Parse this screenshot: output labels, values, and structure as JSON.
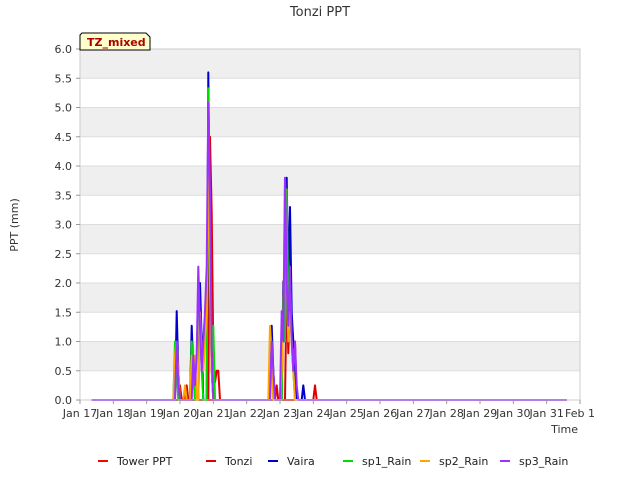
{
  "chart_data": {
    "type": "line",
    "title": "Tonzi PPT",
    "xlabel": "Time",
    "ylabel": "PPT (mm)",
    "badge": "TZ_mixed",
    "ylim": [
      0,
      6.0
    ],
    "xlim": [
      17,
      32
    ],
    "y_ticks": [
      "0.0",
      "0.5",
      "1.0",
      "1.5",
      "2.0",
      "2.5",
      "3.0",
      "3.5",
      "4.0",
      "4.5",
      "5.0",
      "5.5",
      "6.0"
    ],
    "x_ticks": [
      {
        "value": 17,
        "label": "Jan 17"
      },
      {
        "value": 18,
        "label": "Jan 18"
      },
      {
        "value": 19,
        "label": "Jan 19"
      },
      {
        "value": 20,
        "label": "Jan 20"
      },
      {
        "value": 21,
        "label": "Jan 21"
      },
      {
        "value": 22,
        "label": "Jan 22"
      },
      {
        "value": 23,
        "label": "Jan 23"
      },
      {
        "value": 24,
        "label": "Jan 24"
      },
      {
        "value": 25,
        "label": "Jan 25"
      },
      {
        "value": 26,
        "label": "Jan 26"
      },
      {
        "value": 27,
        "label": "Jan 27"
      },
      {
        "value": 28,
        "label": "Jan 28"
      },
      {
        "value": 29,
        "label": "Jan 29"
      },
      {
        "value": 30,
        "label": "Jan 30"
      },
      {
        "value": 31,
        "label": "Jan 31"
      },
      {
        "value": 32,
        "label": "Feb 1"
      }
    ],
    "grid": true,
    "legend_position": "bottom",
    "series": [
      {
        "name": "Tower PPT",
        "color": "#ff0000",
        "points": [
          [
            17.35,
            0
          ],
          [
            31.6,
            0
          ]
        ]
      },
      {
        "name": "Tonzi",
        "color": "#dd0000",
        "points": [
          [
            17.35,
            0
          ],
          [
            19.95,
            0
          ],
          [
            20.0,
            0.25
          ],
          [
            20.05,
            0
          ],
          [
            20.15,
            0
          ],
          [
            20.2,
            0.25
          ],
          [
            20.25,
            0
          ],
          [
            20.85,
            0
          ],
          [
            20.9,
            4.5
          ],
          [
            20.95,
            3.2
          ],
          [
            21.0,
            0.8
          ],
          [
            21.05,
            0.3
          ],
          [
            21.1,
            0.5
          ],
          [
            21.15,
            0.5
          ],
          [
            21.2,
            0
          ],
          [
            22.85,
            0
          ],
          [
            22.9,
            0.25
          ],
          [
            22.95,
            0
          ],
          [
            23.15,
            0
          ],
          [
            23.2,
            2.0
          ],
          [
            23.25,
            0.8
          ],
          [
            23.3,
            1.8
          ],
          [
            23.35,
            1.2
          ],
          [
            23.4,
            0.5
          ],
          [
            23.45,
            1.0
          ],
          [
            23.5,
            0
          ],
          [
            24.0,
            0
          ],
          [
            24.05,
            0.25
          ],
          [
            24.1,
            0
          ],
          [
            31.6,
            0
          ]
        ]
      },
      {
        "name": "Vaira",
        "color": "#0000cc",
        "points": [
          [
            17.35,
            0
          ],
          [
            19.85,
            0
          ],
          [
            19.9,
            1.52
          ],
          [
            19.95,
            0.5
          ],
          [
            20.0,
            0
          ],
          [
            20.3,
            0
          ],
          [
            20.35,
            1.27
          ],
          [
            20.4,
            0.5
          ],
          [
            20.45,
            0
          ],
          [
            20.55,
            0
          ],
          [
            20.6,
            2.0
          ],
          [
            20.65,
            1.0
          ],
          [
            20.7,
            0
          ],
          [
            20.8,
            0
          ],
          [
            20.85,
            5.6
          ],
          [
            20.9,
            2.5
          ],
          [
            20.95,
            0.5
          ],
          [
            21.0,
            0
          ],
          [
            22.7,
            0
          ],
          [
            22.75,
            1.27
          ],
          [
            22.8,
            0.5
          ],
          [
            22.85,
            0
          ],
          [
            23.05,
            0
          ],
          [
            23.1,
            2.03
          ],
          [
            23.15,
            1.0
          ],
          [
            23.2,
            3.8
          ],
          [
            23.25,
            2.0
          ],
          [
            23.3,
            3.3
          ],
          [
            23.35,
            1.5
          ],
          [
            23.4,
            1.0
          ],
          [
            23.45,
            0.5
          ],
          [
            23.5,
            0
          ],
          [
            23.65,
            0
          ],
          [
            23.7,
            0.25
          ],
          [
            23.75,
            0
          ],
          [
            31.6,
            0
          ]
        ]
      },
      {
        "name": "sp1_Rain",
        "color": "#00dd00",
        "points": [
          [
            17.35,
            0
          ],
          [
            19.8,
            0
          ],
          [
            19.85,
            1.0
          ],
          [
            19.9,
            0.5
          ],
          [
            19.95,
            0
          ],
          [
            20.3,
            0
          ],
          [
            20.35,
            1.0
          ],
          [
            20.4,
            0.5
          ],
          [
            20.45,
            0
          ],
          [
            20.55,
            0
          ],
          [
            20.6,
            1.5
          ],
          [
            20.65,
            0.5
          ],
          [
            20.7,
            0
          ],
          [
            20.8,
            0
          ],
          [
            20.85,
            5.33
          ],
          [
            20.9,
            2.0
          ],
          [
            20.95,
            0.8
          ],
          [
            21.0,
            1.27
          ],
          [
            21.05,
            0
          ],
          [
            22.7,
            0
          ],
          [
            22.75,
            1.0
          ],
          [
            22.8,
            0
          ],
          [
            23.05,
            0
          ],
          [
            23.1,
            1.78
          ],
          [
            23.15,
            1.0
          ],
          [
            23.2,
            3.6
          ],
          [
            23.25,
            1.5
          ],
          [
            23.3,
            2.0
          ],
          [
            23.35,
            1.0
          ],
          [
            23.4,
            0.5
          ],
          [
            23.45,
            0
          ],
          [
            31.6,
            0
          ]
        ]
      },
      {
        "name": "sp2_Rain",
        "color": "#ffa500",
        "points": [
          [
            17.35,
            0
          ],
          [
            19.8,
            0
          ],
          [
            19.85,
            0.76
          ],
          [
            19.9,
            1.0
          ],
          [
            19.95,
            0.5
          ],
          [
            20.0,
            0
          ],
          [
            20.1,
            0
          ],
          [
            20.15,
            0.25
          ],
          [
            20.2,
            0
          ],
          [
            20.3,
            0
          ],
          [
            20.35,
            0.76
          ],
          [
            20.4,
            0.5
          ],
          [
            20.45,
            0.76
          ],
          [
            20.5,
            0
          ],
          [
            20.55,
            0
          ],
          [
            20.6,
            1.5
          ],
          [
            20.65,
            0.76
          ],
          [
            20.7,
            0.5
          ],
          [
            20.75,
            1.0
          ],
          [
            20.8,
            1.5
          ],
          [
            20.85,
            4.5
          ],
          [
            20.9,
            2.0
          ],
          [
            20.95,
            0.5
          ],
          [
            21.0,
            0
          ],
          [
            22.65,
            0
          ],
          [
            22.7,
            1.27
          ],
          [
            22.75,
            0.76
          ],
          [
            22.8,
            0
          ],
          [
            23.0,
            0
          ],
          [
            23.05,
            0.5
          ],
          [
            23.1,
            1.27
          ],
          [
            23.15,
            3.8
          ],
          [
            23.2,
            2.03
          ],
          [
            23.25,
            1.0
          ],
          [
            23.3,
            1.5
          ],
          [
            23.35,
            1.0
          ],
          [
            23.4,
            0.5
          ],
          [
            23.45,
            0
          ],
          [
            31.6,
            0
          ]
        ]
      },
      {
        "name": "sp3_Rain",
        "color": "#9b30ff",
        "points": [
          [
            17.35,
            0
          ],
          [
            19.85,
            0
          ],
          [
            19.9,
            1.0
          ],
          [
            19.95,
            0.3
          ],
          [
            20.0,
            0
          ],
          [
            20.35,
            0
          ],
          [
            20.4,
            0.76
          ],
          [
            20.45,
            0.25
          ],
          [
            20.5,
            0.76
          ],
          [
            20.55,
            2.28
          ],
          [
            20.6,
            1.27
          ],
          [
            20.65,
            0.5
          ],
          [
            20.7,
            1.0
          ],
          [
            20.75,
            1.52
          ],
          [
            20.8,
            2.28
          ],
          [
            20.85,
            5.08
          ],
          [
            20.9,
            3.55
          ],
          [
            20.95,
            0.76
          ],
          [
            21.0,
            0
          ],
          [
            22.7,
            0
          ],
          [
            22.75,
            1.0
          ],
          [
            22.8,
            0.5
          ],
          [
            22.85,
            0
          ],
          [
            23.0,
            0
          ],
          [
            23.05,
            1.52
          ],
          [
            23.1,
            1.0
          ],
          [
            23.15,
            3.8
          ],
          [
            23.2,
            2.0
          ],
          [
            23.25,
            1.27
          ],
          [
            23.3,
            2.28
          ],
          [
            23.35,
            1.0
          ],
          [
            23.4,
            0.5
          ],
          [
            23.45,
            1.0
          ],
          [
            23.5,
            0.25
          ],
          [
            23.55,
            0
          ],
          [
            31.6,
            0
          ]
        ]
      }
    ]
  }
}
